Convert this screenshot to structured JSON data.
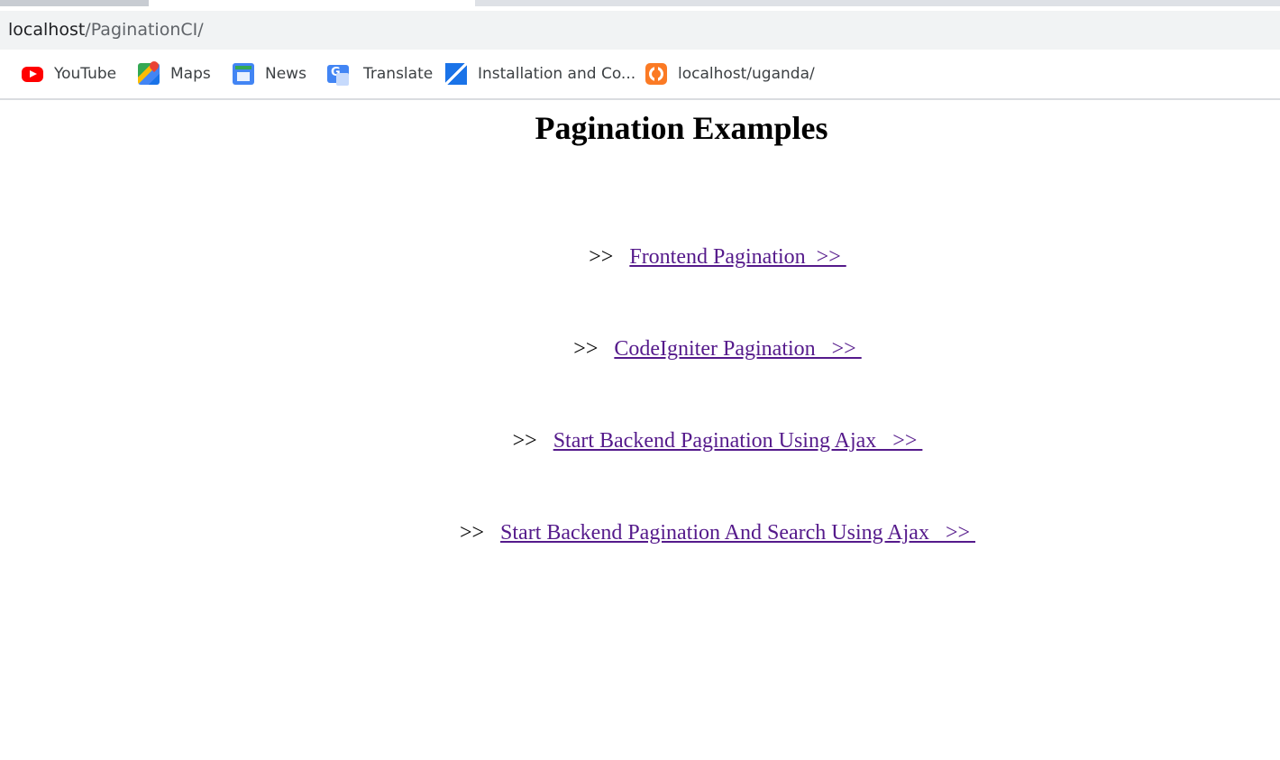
{
  "browser": {
    "address_host": "localhost",
    "address_path": "/PaginationCI/"
  },
  "bookmarks": [
    {
      "label": "YouTube",
      "icon": "youtube-icon"
    },
    {
      "label": "Maps",
      "icon": "maps-icon"
    },
    {
      "label": "News",
      "icon": "news-icon"
    },
    {
      "label": "Translate",
      "icon": "translate-icon"
    },
    {
      "label": "Installation and Co...",
      "icon": "zendesk-icon"
    },
    {
      "label": "localhost/uganda/",
      "icon": "xampp-icon"
    }
  ],
  "page": {
    "title": "Pagination Examples",
    "links": [
      {
        "prefix": ">>   ",
        "label": "Frontend Pagination  >> "
      },
      {
        "prefix": ">>   ",
        "label": "CodeIgniter Pagination   >> "
      },
      {
        "prefix": ">>   ",
        "label": "Start Backend Pagination Using Ajax   >> "
      },
      {
        "prefix": ">>   ",
        "label": "Start Backend Pagination And Search Using Ajax   >> "
      }
    ]
  },
  "colors": {
    "link_visited": "#551a8b",
    "omnibox_bg": "#f1f3f4"
  }
}
